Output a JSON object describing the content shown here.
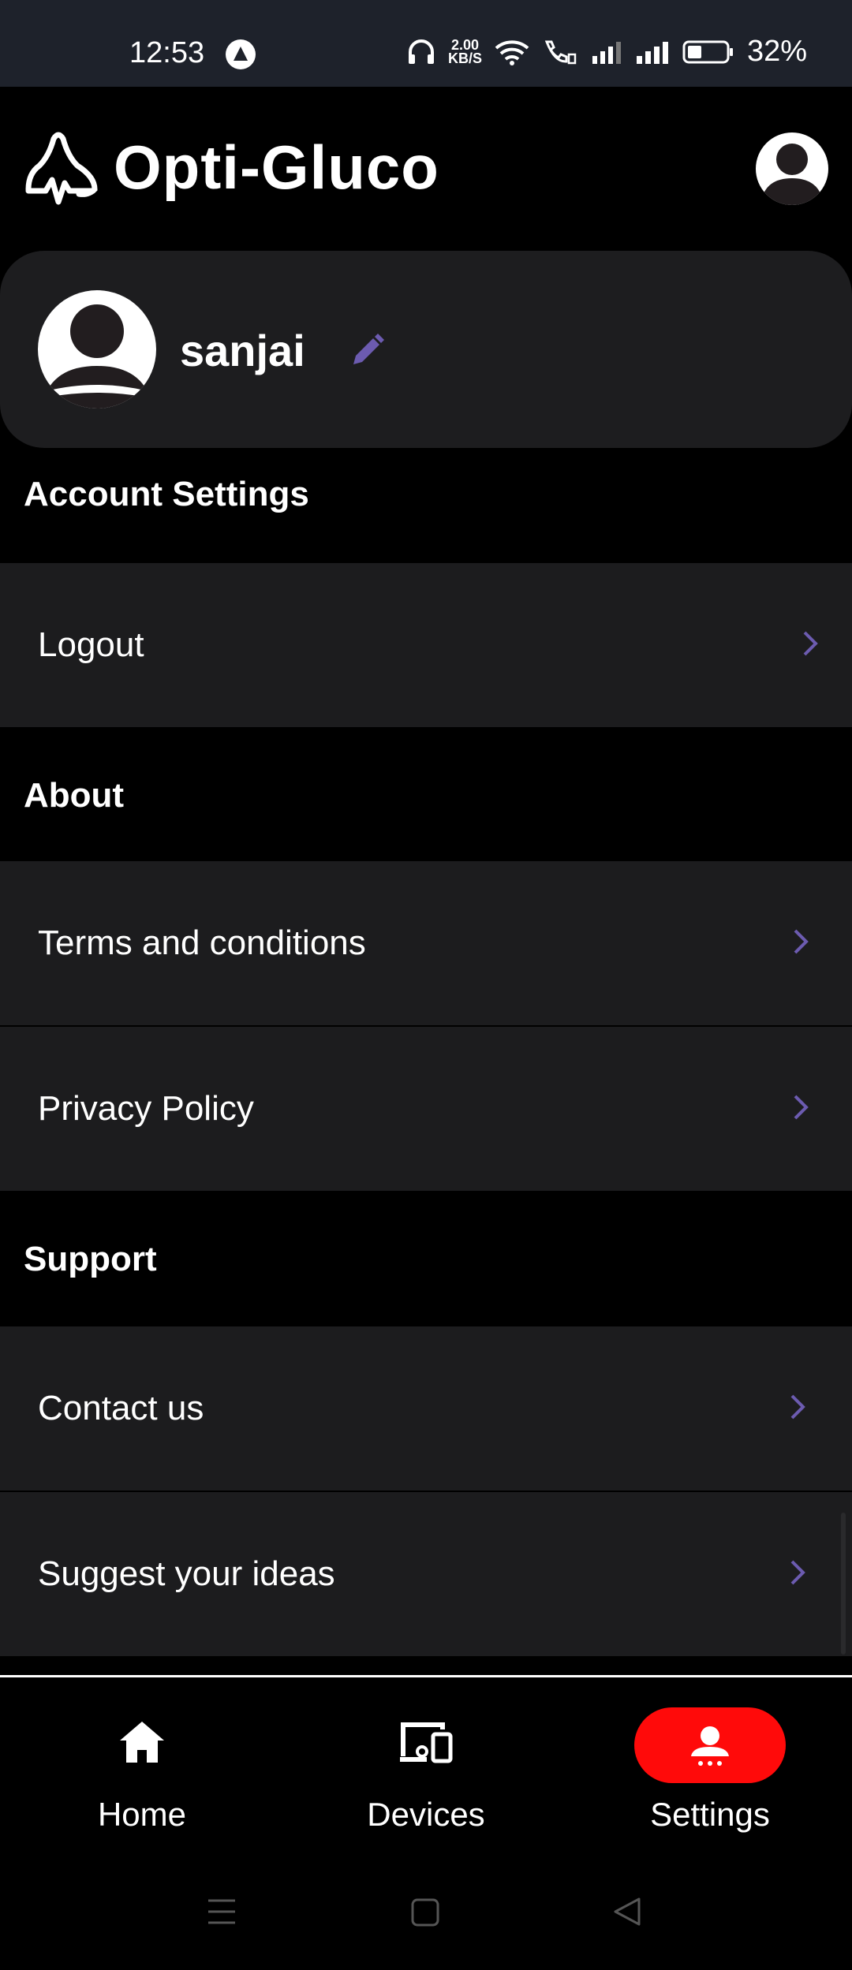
{
  "status_bar": {
    "time": "12:53",
    "net_speed_value": "2.00",
    "net_speed_unit": "KB/S",
    "battery": "32%"
  },
  "header": {
    "app_name": "Opti-Gluco",
    "avatar_icon": "user-avatar-icon"
  },
  "profile": {
    "name": "sanjai",
    "edit_icon": "pencil-icon"
  },
  "sections": {
    "account_title": "Account Settings",
    "logout": "Logout",
    "about_title": "About",
    "terms": "Terms and conditions",
    "privacy": "Privacy Policy",
    "support_title": "Support",
    "contact": "Contact us",
    "suggest": "Suggest your ideas"
  },
  "bottom_nav": {
    "home": "Home",
    "devices": "Devices",
    "settings": "Settings",
    "active": "Settings"
  },
  "colors": {
    "accent": "#6c5bb0",
    "active_nav": "#ff0a0a",
    "row_bg": "#1c1c1e",
    "background": "#000000"
  }
}
